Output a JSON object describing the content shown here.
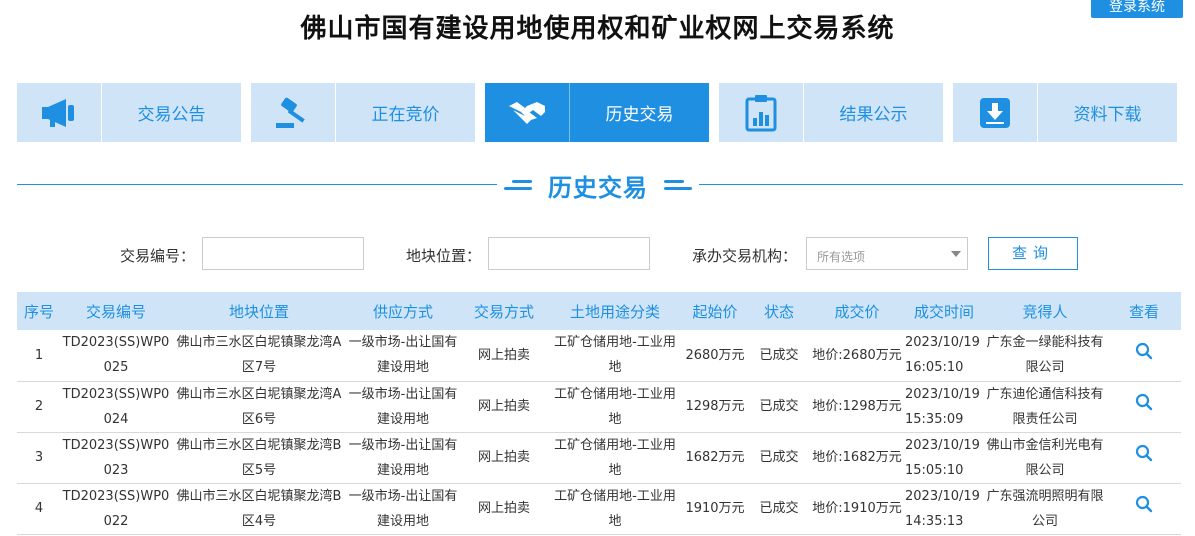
{
  "header": {
    "login_label": "登录系统",
    "site_title": "佛山市国有建设用地使用权和矿业权网上交易系统"
  },
  "nav": {
    "items": [
      {
        "label": "交易公告",
        "icon": "megaphone-icon"
      },
      {
        "label": "正在竞价",
        "icon": "gavel-icon"
      },
      {
        "label": "历史交易",
        "icon": "handshake-icon",
        "active": true
      },
      {
        "label": "结果公示",
        "icon": "clipboard-chart-icon"
      },
      {
        "label": "资料下载",
        "icon": "download-icon"
      }
    ]
  },
  "section": {
    "title": "历史交易"
  },
  "search": {
    "trade_no_label": "交易编号：",
    "trade_no_value": "",
    "location_label": "地块位置：",
    "location_value": "",
    "agency_label": "承办交易机构：",
    "agency_selected": "所有选项",
    "query_label": "查询"
  },
  "table": {
    "headers": [
      "序号",
      "交易编号",
      "地块位置",
      "供应方式",
      "交易方式",
      "土地用途分类",
      "起始价",
      "状态",
      "成交价",
      "成交时间",
      "竞得人",
      "查看"
    ],
    "rows": [
      {
        "no": "1",
        "code": "TD2023(SS)WP0025",
        "location": "佛山市三水区白坭镇聚龙湾A区7号",
        "supply": "一级市场-出让国有建设用地",
        "method": "网上拍卖",
        "usage": "工矿仓储用地-工业用地",
        "start_price": "2680万元",
        "status": "已成交",
        "deal_price": "地价:2680万元",
        "deal_time": "2023/10/19 16:05:10",
        "winner": "广东金一绿能科技有限公司"
      },
      {
        "no": "2",
        "code": "TD2023(SS)WP0024",
        "location": "佛山市三水区白坭镇聚龙湾A区6号",
        "supply": "一级市场-出让国有建设用地",
        "method": "网上拍卖",
        "usage": "工矿仓储用地-工业用地",
        "start_price": "1298万元",
        "status": "已成交",
        "deal_price": "地价:1298万元",
        "deal_time": "2023/10/19 15:35:09",
        "winner": "广东迪伦通信科技有限责任公司"
      },
      {
        "no": "3",
        "code": "TD2023(SS)WP0023",
        "location": "佛山市三水区白坭镇聚龙湾B区5号",
        "supply": "一级市场-出让国有建设用地",
        "method": "网上拍卖",
        "usage": "工矿仓储用地-工业用地",
        "start_price": "1682万元",
        "status": "已成交",
        "deal_price": "地价:1682万元",
        "deal_time": "2023/10/19 15:05:10",
        "winner": "佛山市金信利光电有限公司"
      },
      {
        "no": "4",
        "code": "TD2023(SS)WP0022",
        "location": "佛山市三水区白坭镇聚龙湾B区4号",
        "supply": "一级市场-出让国有建设用地",
        "method": "网上拍卖",
        "usage": "工矿仓储用地-工业用地",
        "start_price": "1910万元",
        "status": "已成交",
        "deal_price": "地价:1910万元",
        "deal_time": "2023/10/19 14:35:13",
        "winner": "广东强流明照明有限公司"
      }
    ]
  },
  "colors": {
    "accent": "#1e8fe1",
    "nav_bg": "#cfe5f7",
    "header_row_bg": "#cfe5f7"
  }
}
